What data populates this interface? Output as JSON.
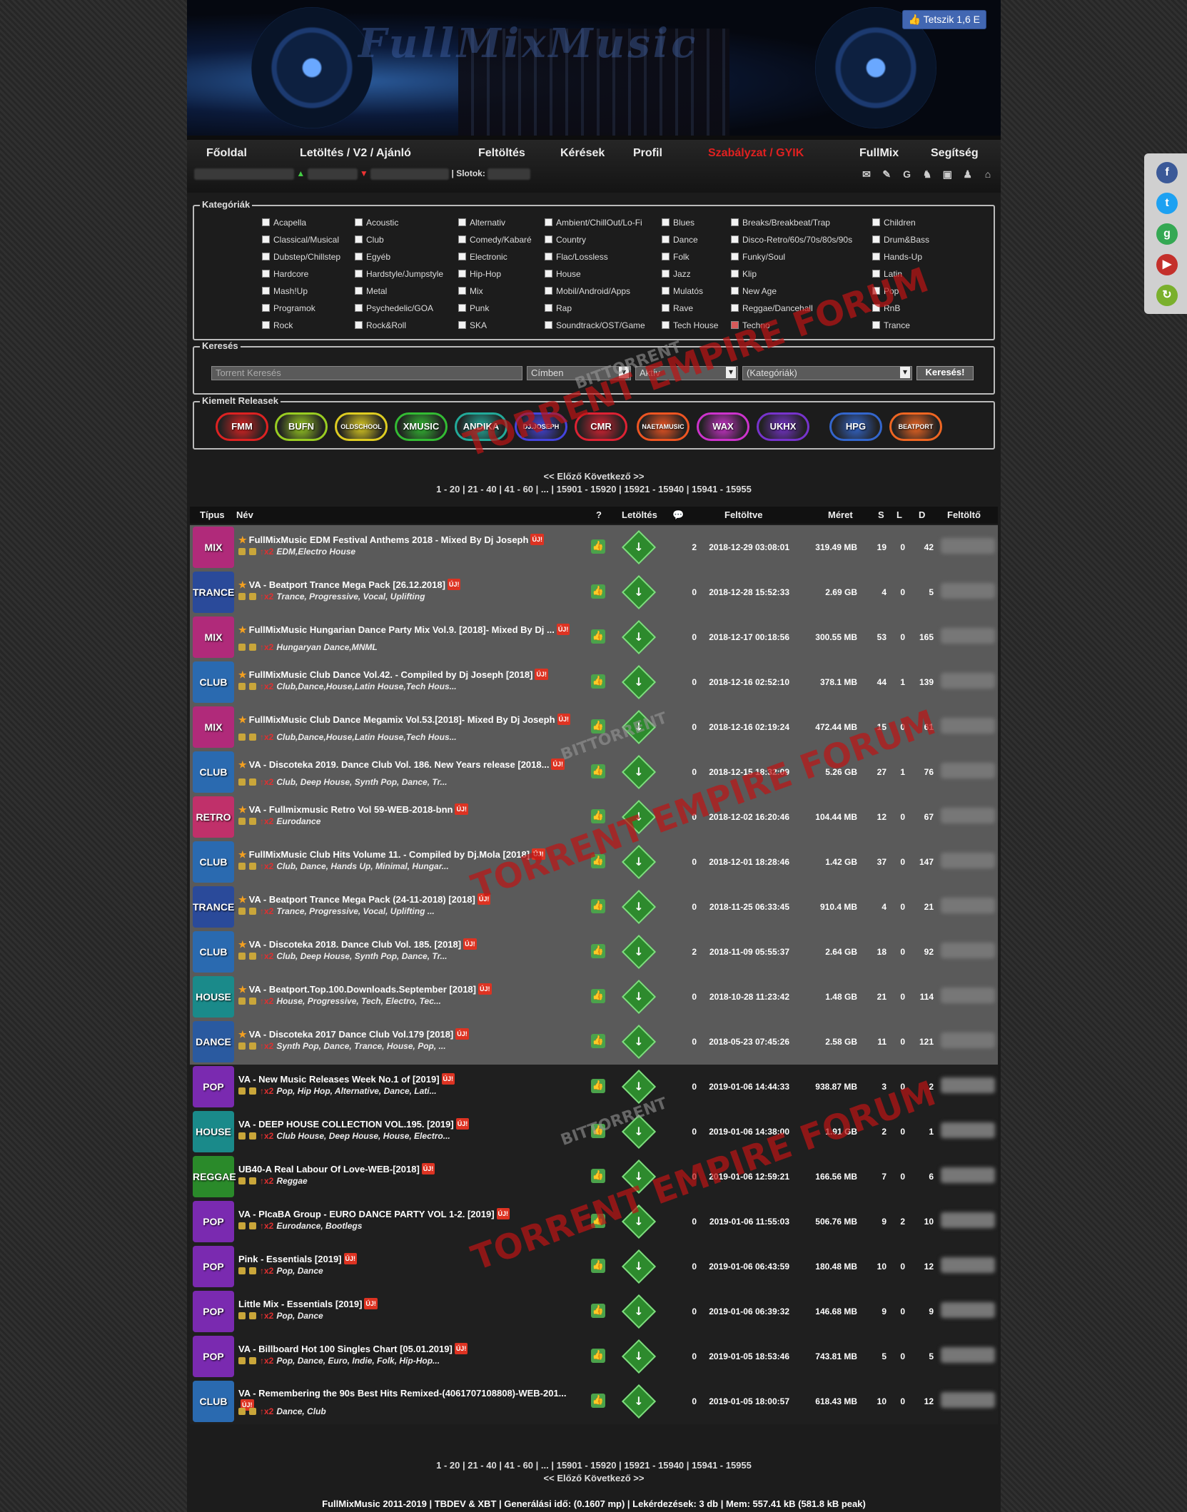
{
  "banner": {
    "like_label": "Tetszik 1,6 E"
  },
  "nav": {
    "items": [
      "Főoldal",
      "Letöltés / V2 / Ajánló",
      "Feltöltés",
      "Kérések",
      "Profil",
      "Szabályzat / GYIK",
      "FullMix",
      "Segítség"
    ],
    "slots_label": "| Slotok:"
  },
  "categories": {
    "legend": "Kategóriák",
    "items": [
      "Acapella",
      "Acoustic",
      "Alternativ",
      "Ambient/ChillOut/Lo-Fi",
      "Blues",
      "Breaks/Breakbeat/Trap",
      "Children",
      "Classical/Musical",
      "Club",
      "Comedy/Kabaré",
      "Country",
      "Dance",
      "Disco-Retro/60s/70s/80s/90s",
      "Drum&Bass",
      "Dubstep/Chillstep",
      "Egyéb",
      "Electronic",
      "Flac/Lossless",
      "Folk",
      "Funky/Soul",
      "Hands-Up",
      "Hardcore",
      "Hardstyle/Jumpstyle",
      "Hip-Hop",
      "House",
      "Jazz",
      "Klip",
      "Latin",
      "Mash!Up",
      "Metal",
      "Mix",
      "Mobil/Android/Apps",
      "Mulatós",
      "New Age",
      "Pop",
      "Programok",
      "Psychedelic/GOA",
      "Punk",
      "Rap",
      "Rave",
      "Reggae/Dancehall",
      "RnB",
      "Rock",
      "Rock&Roll",
      "SKA",
      "Soundtrack/OST/Game",
      "Tech House",
      "Techno",
      "Trance"
    ]
  },
  "search": {
    "legend": "Keresés",
    "placeholder": "Torrent Keresés",
    "field2": "Címben",
    "field3": "Aktív",
    "field4": "(Kategóriák)",
    "button": "Keresés!"
  },
  "releases": {
    "legend": "Kiemelt Releasek",
    "items": [
      "FMM",
      "BUFN",
      "OLDSCHOOL",
      "XMUSIC",
      "ANDIKA",
      "DJ.JOSEPH",
      "CMR",
      "NAETAMUSIC",
      "WAX",
      "UKHX",
      "HPG",
      "BEATPORT"
    ]
  },
  "pager": {
    "nav": "<< Előző     Következő >>",
    "pages": "1 - 20 | 21 - 40 | 41 - 60 | ... | 15901 - 15920 | 15921 - 15940 | 15941 - 15955"
  },
  "table": {
    "headers": [
      "Típus",
      "Név",
      "?",
      "Letöltés",
      "Feltöltve",
      "Méret",
      "S",
      "L",
      "D",
      "Feltöltő"
    ],
    "new_badge": "ÚJ!",
    "rows": [
      {
        "thumb": "MIX",
        "name": "FullMixMusic EDM Festival Anthems 2018 - Mixed By Dj Joseph",
        "genre": "EDM,Electro House",
        "c": "2",
        "date": "2018-12-29 03:08:01",
        "size": "319.49 MB",
        "s": "19",
        "l": "0",
        "d": "42"
      },
      {
        "thumb": "TRANCE",
        "name": "VA - Beatport Trance Mega Pack [26.12.2018]",
        "genre": "Trance, Progressive, Vocal, Uplifting",
        "c": "0",
        "date": "2018-12-28 15:52:33",
        "size": "2.69 GB",
        "s": "4",
        "l": "0",
        "d": "5"
      },
      {
        "thumb": "MIX",
        "name": "FullMixMusic Hungarian Dance Party Mix Vol.9. [2018]- Mixed By Dj ...",
        "genre": "Hungaryan Dance,MNML",
        "c": "0",
        "date": "2018-12-17 00:18:56",
        "size": "300.55 MB",
        "s": "53",
        "l": "0",
        "d": "165"
      },
      {
        "thumb": "CLUB",
        "name": "FullMixMusic Club Dance Vol.42. - Compiled by Dj Joseph [2018]",
        "genre": "Club,Dance,House,Latin House,Tech Hous...",
        "c": "0",
        "date": "2018-12-16 02:52:10",
        "size": "378.1 MB",
        "s": "44",
        "l": "1",
        "d": "139"
      },
      {
        "thumb": "MIX",
        "name": "FullMixMusic Club Dance Megamix Vol.53.[2018]- Mixed By Dj Joseph",
        "genre": "Club,Dance,House,Latin House,Tech Hous...",
        "c": "0",
        "date": "2018-12-16 02:19:24",
        "size": "472.44 MB",
        "s": "15",
        "l": "0",
        "d": "61"
      },
      {
        "thumb": "CLUB",
        "name": "VA - Discoteka 2019. Dance Club Vol. 186. New Years release [2018...",
        "genre": "Club, Deep House, Synth Pop, Dance, Tr...",
        "c": "0",
        "date": "2018-12-15 18:32:09",
        "size": "5.26 GB",
        "s": "27",
        "l": "1",
        "d": "76"
      },
      {
        "thumb": "RETRO",
        "name": "VA - Fullmixmusic Retro Vol 59-WEB-2018-bnn",
        "genre": "Eurodance",
        "c": "0",
        "date": "2018-12-02 16:20:46",
        "size": "104.44 MB",
        "s": "12",
        "l": "0",
        "d": "67"
      },
      {
        "thumb": "CLUB",
        "name": "FullMixMusic Club Hits Volume 11. - Compiled by Dj.Mola [2018]",
        "genre": "Club, Dance, Hands Up, Minimal, Hungar...",
        "c": "0",
        "date": "2018-12-01 18:28:46",
        "size": "1.42 GB",
        "s": "37",
        "l": "0",
        "d": "147"
      },
      {
        "thumb": "TRANCE",
        "name": "VA - Beatport Trance Mega Pack (24-11-2018) [2018]",
        "genre": "Trance, Progressive, Vocal, Uplifting ...",
        "c": "0",
        "date": "2018-11-25 06:33:45",
        "size": "910.4 MB",
        "s": "4",
        "l": "0",
        "d": "21"
      },
      {
        "thumb": "CLUB",
        "name": "VA - Discoteka 2018. Dance Club Vol. 185. [2018]",
        "genre": "Club, Deep House, Synth Pop, Dance, Tr...",
        "c": "2",
        "date": "2018-11-09 05:55:37",
        "size": "2.64 GB",
        "s": "18",
        "l": "0",
        "d": "92"
      },
      {
        "thumb": "HOUSE",
        "name": "VA - Beatport.Top.100.Downloads.September [2018]",
        "genre": "House, Progressive, Tech, Electro, Tec...",
        "c": "0",
        "date": "2018-10-28 11:23:42",
        "size": "1.48 GB",
        "s": "21",
        "l": "0",
        "d": "114"
      },
      {
        "thumb": "DANCE",
        "name": "VA - Discoteka 2017 Dance Club Vol.179 [2018]",
        "genre": "Synth Pop, Dance, Trance, House, Pop, ...",
        "c": "0",
        "date": "2018-05-23 07:45:26",
        "size": "2.58 GB",
        "s": "11",
        "l": "0",
        "d": "121"
      },
      {
        "thumb": "POP",
        "name": "VA - New Music Releases Week No.1 of [2019]",
        "genre": "Pop, Hip Hop, Alternative, Dance, Lati...",
        "c": "0",
        "date": "2019-01-06 14:44:33",
        "size": "938.87 MB",
        "s": "3",
        "l": "0",
        "d": "2"
      },
      {
        "thumb": "HOUSE",
        "name": "VA - DEEP HOUSE COLLECTION VOL.195. [2019]",
        "genre": "Club House, Deep House, House, Electro...",
        "c": "0",
        "date": "2019-01-06 14:38:00",
        "size": "1.91 GB",
        "s": "2",
        "l": "0",
        "d": "1"
      },
      {
        "thumb": "REGGAE",
        "name": "UB40-A Real Labour Of Love-WEB-[2018]",
        "genre": "Reggae",
        "c": "0",
        "date": "2019-01-06 12:59:21",
        "size": "166.56 MB",
        "s": "7",
        "l": "0",
        "d": "6"
      },
      {
        "thumb": "POP",
        "name": "VA - PIcaBA Group - EURO DANCE PARTY VOL 1-2. [2019]",
        "genre": "Eurodance, Bootlegs",
        "c": "0",
        "date": "2019-01-06 11:55:03",
        "size": "506.76 MB",
        "s": "9",
        "l": "2",
        "d": "10"
      },
      {
        "thumb": "POP",
        "name": "Pink - Essentials [2019]",
        "genre": "Pop, Dance",
        "c": "0",
        "date": "2019-01-06 06:43:59",
        "size": "180.48 MB",
        "s": "10",
        "l": "0",
        "d": "12"
      },
      {
        "thumb": "POP",
        "name": "Little Mix - Essentials [2019]",
        "genre": "Pop, Dance",
        "c": "0",
        "date": "2019-01-06 06:39:32",
        "size": "146.68 MB",
        "s": "9",
        "l": "0",
        "d": "9"
      },
      {
        "thumb": "POP",
        "name": "VA - Billboard Hot 100 Singles Chart [05.01.2019]",
        "genre": "Pop, Dance, Euro, Indie, Folk, Hip-Hop...",
        "c": "0",
        "date": "2019-01-05 18:53:46",
        "size": "743.81 MB",
        "s": "5",
        "l": "0",
        "d": "5"
      },
      {
        "thumb": "CLUB",
        "name": "VA - Remembering the 90s Best Hits Remixed-(4061707108808)-WEB-201...",
        "genre": "Dance, Club",
        "c": "0",
        "date": "2019-01-05 18:00:57",
        "size": "618.43 MB",
        "s": "10",
        "l": "0",
        "d": "12"
      }
    ]
  },
  "footer": "FullMixMusic 2011-2019 | TBDEV & XBT | Generálási idő: (0.1607 mp) | Lekérdezések: 3 db | Mem: 557.41 kB (581.8 kB peak)",
  "watermark": {
    "line1": "TORRENT EMPIRE FORUM",
    "line2": "BITTORRENT"
  },
  "colors": {
    "accent_red": "#e02020",
    "highlight_row": "#5a5a5a",
    "download_green": "#2d8a2d"
  }
}
